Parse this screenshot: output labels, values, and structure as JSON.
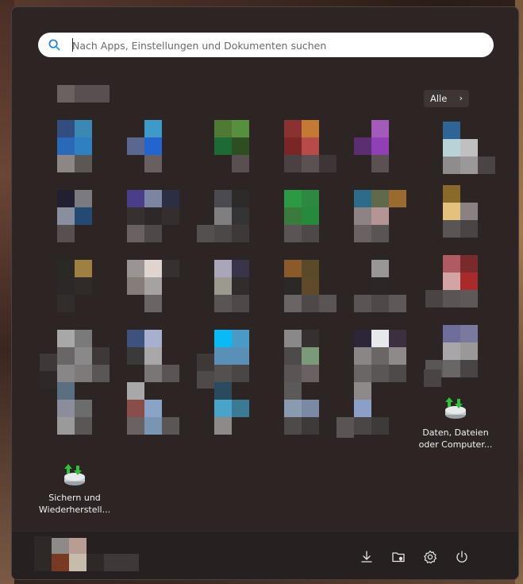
{
  "search": {
    "placeholder": "Nach Apps, Einstellungen und Dokumenten suchen",
    "value": ""
  },
  "pinned": {
    "all_label": "Alle"
  },
  "apps": {
    "backup_restore": {
      "line1": "Sichern und",
      "line2": "Wiederherstell..."
    },
    "data_files": {
      "line1": "Daten, Dateien",
      "line2": "oder Computer..."
    }
  },
  "footer": {
    "icons": [
      "download-icon",
      "folder-icon",
      "gear-icon",
      "power-icon"
    ]
  },
  "colors": {
    "menu_bg": "#2c2523",
    "search_bg": "#ffffff",
    "accent": "#1e7bd6"
  }
}
